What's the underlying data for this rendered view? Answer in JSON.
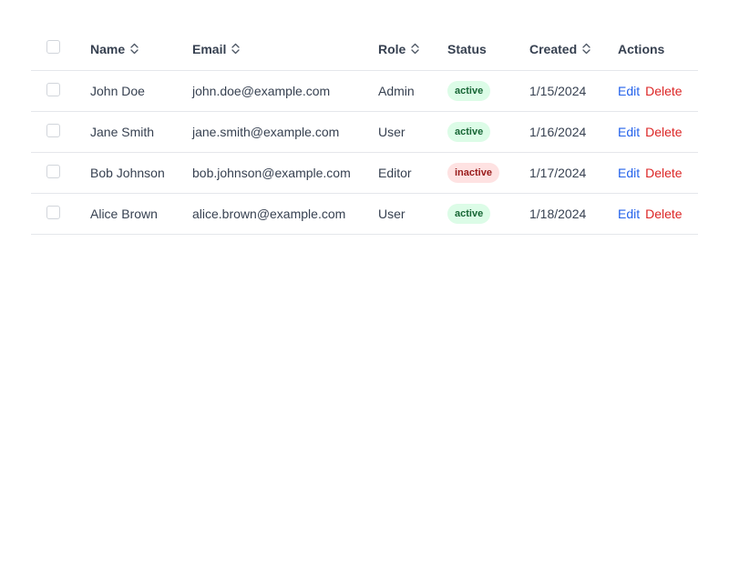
{
  "table": {
    "headers": {
      "name": "Name",
      "email": "Email",
      "role": "Role",
      "status": "Status",
      "created": "Created",
      "actions": "Actions"
    },
    "sort_icon": "sort-updown-icon",
    "rows": [
      {
        "name": "John Doe",
        "email": "john.doe@example.com",
        "role": "Admin",
        "status": "active",
        "created": "1/15/2024",
        "edit": "Edit",
        "delete": "Delete"
      },
      {
        "name": "Jane Smith",
        "email": "jane.smith@example.com",
        "role": "User",
        "status": "active",
        "created": "1/16/2024",
        "edit": "Edit",
        "delete": "Delete"
      },
      {
        "name": "Bob Johnson",
        "email": "bob.johnson@example.com",
        "role": "Editor",
        "status": "inactive",
        "created": "1/17/2024",
        "edit": "Edit",
        "delete": "Delete"
      },
      {
        "name": "Alice Brown",
        "email": "alice.brown@example.com",
        "role": "User",
        "status": "active",
        "created": "1/18/2024",
        "edit": "Edit",
        "delete": "Delete"
      }
    ]
  },
  "colors": {
    "active_bg": "#dcfce7",
    "active_text": "#166534",
    "inactive_bg": "#fee2e2",
    "inactive_text": "#991b1b",
    "edit_link": "#2563eb",
    "delete_link": "#dc2626"
  }
}
